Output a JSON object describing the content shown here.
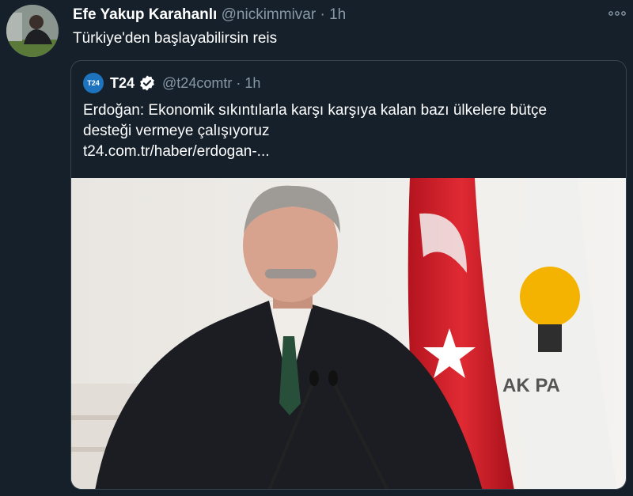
{
  "tweet": {
    "author_name": "Efe Yakup Karahanlı",
    "handle": "@nickimmivar",
    "separator": "·",
    "time": "1h",
    "text": "Türkiye'den başlayabilirsin reis",
    "more_icon": "more-dots-icon"
  },
  "quoted_tweet": {
    "logo_text": "T24",
    "author_name": "T24",
    "handle": "@t24comtr",
    "separator": "·",
    "time": "1h",
    "verified_icon": "verified-badge-icon",
    "text_line1": "Erdoğan: Ekonomik sıkıntılarla karşı karşıya kalan bazı ülkelere bütçe",
    "text_line2": "desteği vermeye çalışıyoruz",
    "link": "t24.com.tr/haber/erdogan-..."
  },
  "image": {
    "flag_star_text": "",
    "banner_text": "AK PA"
  },
  "colors": {
    "background": "#15202b",
    "border": "#38444d",
    "secondary_text": "#8899a6",
    "verified": "#ffffff",
    "flag_red": "#d81e2a"
  }
}
